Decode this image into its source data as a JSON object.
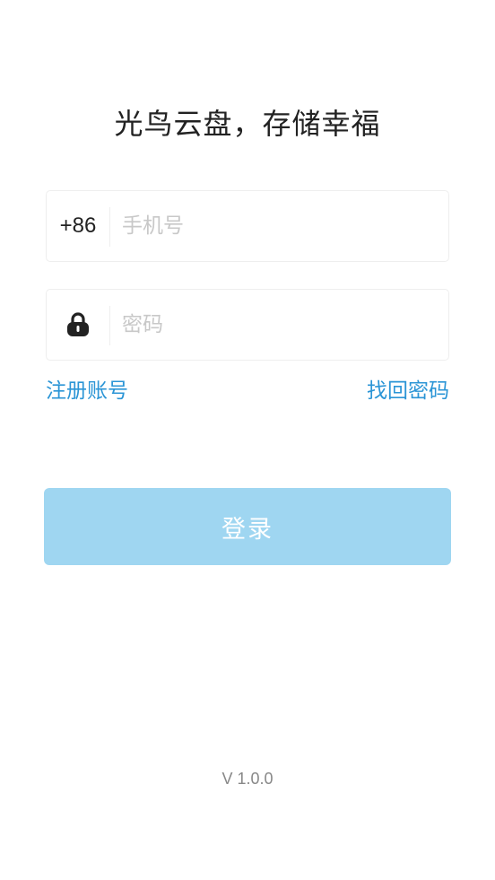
{
  "title": "光鸟云盘，存储幸福",
  "phone_field": {
    "country_code": "+86",
    "placeholder": "手机号",
    "value": ""
  },
  "password_field": {
    "icon": "lock-icon",
    "placeholder": "密码",
    "value": ""
  },
  "links": {
    "register": "注册账号",
    "forgot_password": "找回密码"
  },
  "login_button": {
    "label": "登录",
    "enabled": false
  },
  "version": "V 1.0.0",
  "colors": {
    "accent": "#2b95d6",
    "button_disabled": "#9fd6f1",
    "title": "#222222",
    "placeholder": "#c8c8c8",
    "version": "#888888"
  }
}
